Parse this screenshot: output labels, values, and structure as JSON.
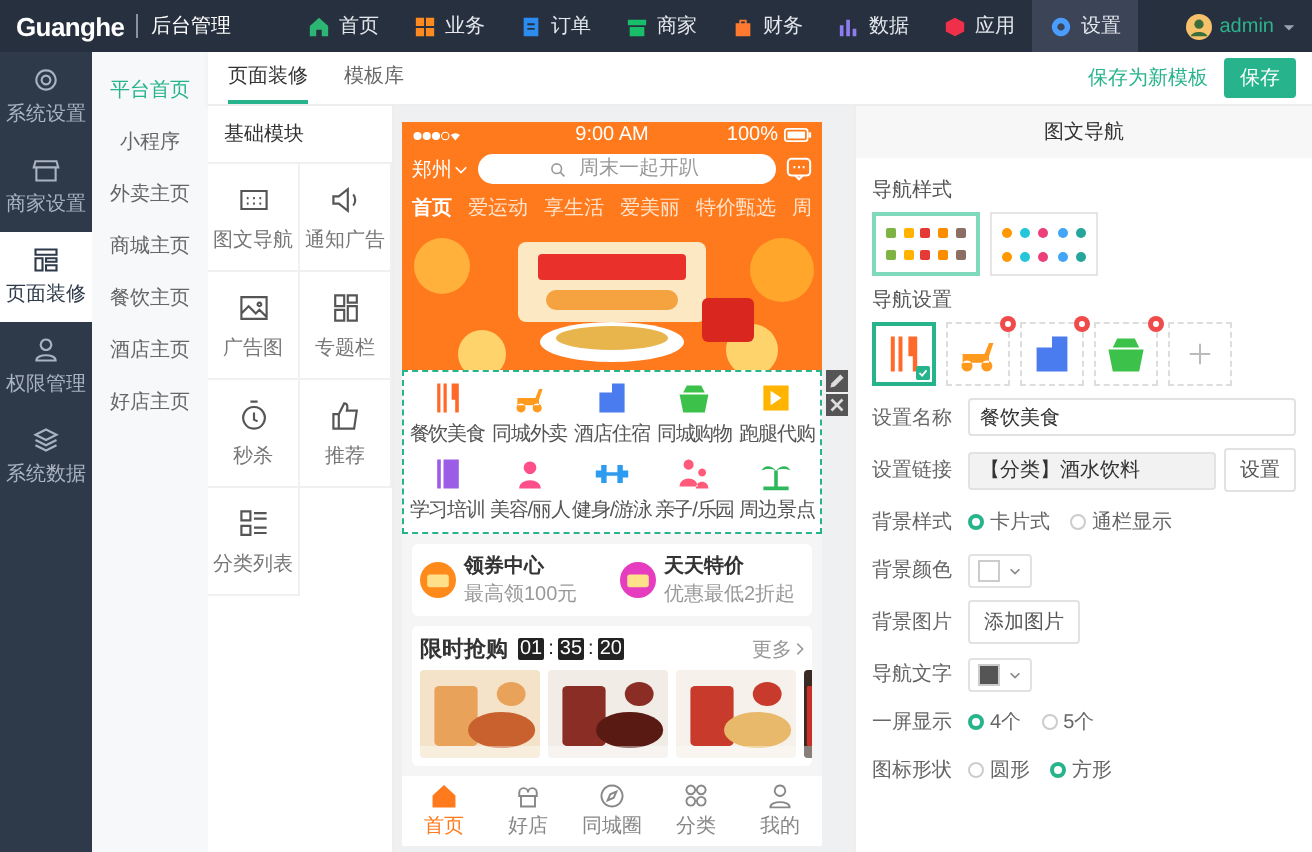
{
  "top_bar": {
    "logo": "Guanghe",
    "title": "后台管理",
    "user": "admin",
    "nav": [
      {
        "label": "首页",
        "color": "#2bb673",
        "selected": false
      },
      {
        "label": "业务",
        "color": "#ff8a1f",
        "selected": false
      },
      {
        "label": "订单",
        "color": "#2d8cf0",
        "selected": false
      },
      {
        "label": "商家",
        "color": "#19be6b",
        "selected": false
      },
      {
        "label": "财务",
        "color": "#ff7a2e",
        "selected": false
      },
      {
        "label": "数据",
        "color": "#8f7cf0",
        "selected": false
      },
      {
        "label": "应用",
        "color": "#f0304a",
        "selected": false
      },
      {
        "label": "设置",
        "color": "#4a9cff",
        "selected": true
      }
    ]
  },
  "rail": [
    {
      "label": "系统设置",
      "selected": false
    },
    {
      "label": "商家设置",
      "selected": false
    },
    {
      "label": "页面装修",
      "selected": true
    },
    {
      "label": "权限管理",
      "selected": false
    },
    {
      "label": "系统数据",
      "selected": false
    }
  ],
  "sub_nav": [
    {
      "label": "平台首页",
      "selected": true
    },
    {
      "label": "小程序",
      "selected": false
    },
    {
      "label": "外卖主页",
      "selected": false
    },
    {
      "label": "商城主页",
      "selected": false
    },
    {
      "label": "餐饮主页",
      "selected": false
    },
    {
      "label": "酒店主页",
      "selected": false
    },
    {
      "label": "好店主页",
      "selected": false
    }
  ],
  "tabs": [
    {
      "label": "页面装修",
      "selected": true
    },
    {
      "label": "模板库",
      "selected": false
    }
  ],
  "actions": {
    "save_template": "保存为新模板",
    "save": "保存"
  },
  "modules": {
    "title": "基础模块",
    "items": [
      "图文导航",
      "通知广告",
      "广告图",
      "专题栏",
      "秒杀",
      "推荐",
      "分类列表"
    ]
  },
  "phone": {
    "status": {
      "time": "9:00 AM",
      "battery": "100%"
    },
    "city": "郑州",
    "search": {
      "placeholder": "周末一起开趴"
    },
    "tabs": [
      {
        "label": "首页",
        "selected": true
      },
      {
        "label": "爱运动",
        "selected": false
      },
      {
        "label": "享生活",
        "selected": false
      },
      {
        "label": "爱美丽",
        "selected": false
      },
      {
        "label": "特价甄选",
        "selected": false
      },
      {
        "label": "周",
        "selected": false
      }
    ],
    "nav_grid": {
      "selected": true,
      "items": [
        {
          "label": "餐饮美食",
          "color": "#ff6a2a"
        },
        {
          "label": "同城外卖",
          "color": "#ff9a1f"
        },
        {
          "label": "酒店住宿",
          "color": "#4a7cf0"
        },
        {
          "label": "同城购物",
          "color": "#3cc24a"
        },
        {
          "label": "跑腿代购",
          "color": "#ffb400"
        },
        {
          "label": "学习培训",
          "color": "#9b5de5"
        },
        {
          "label": "美容/丽人",
          "color": "#ff4f8b"
        },
        {
          "label": "健身/游泳",
          "color": "#2d9cf0"
        },
        {
          "label": "亲子/乐园",
          "color": "#ff5a7a"
        },
        {
          "label": "周边景点",
          "color": "#2eb85c"
        }
      ]
    },
    "promos": [
      {
        "title": "领券中心",
        "subtitle": "最高领100元"
      },
      {
        "title": "天天特价",
        "subtitle": "优惠最低2折起"
      }
    ],
    "flash_sale": {
      "title": "限时抢购",
      "more": "更多",
      "countdown": [
        {
          "kind": "digits",
          "text": "01"
        },
        {
          "kind": "sep",
          "text": ":"
        },
        {
          "kind": "digits",
          "text": "35"
        },
        {
          "kind": "sep",
          "text": ":"
        },
        {
          "kind": "digits",
          "text": "20"
        }
      ]
    },
    "bottom_tabs": [
      {
        "label": "首页",
        "selected": true
      },
      {
        "label": "好店",
        "selected": false
      },
      {
        "label": "同城圈",
        "selected": false
      },
      {
        "label": "分类",
        "selected": false
      },
      {
        "label": "我的",
        "selected": false
      }
    ]
  },
  "panel": {
    "title": "图文导航",
    "style_label": "导航样式",
    "styles": [
      {
        "selected": true
      },
      {
        "selected": false
      }
    ],
    "tiles_label": "导航设置",
    "tiles": [
      {
        "selected": true,
        "removable": false,
        "color": "#ff6a2a"
      },
      {
        "selected": false,
        "removable": true,
        "color": "#ff9a1f"
      },
      {
        "selected": false,
        "removable": true,
        "color": "#4a7cf0"
      },
      {
        "selected": false,
        "removable": true,
        "color": "#3cc24a"
      }
    ],
    "fields": [
      {
        "kind": "text",
        "label": "设置名称",
        "value": "餐饮美食"
      },
      {
        "kind": "link",
        "label": "设置链接",
        "value": "【分类】酒水饮料",
        "button": "设置"
      },
      {
        "kind": "radio",
        "label": "背景样式",
        "options": [
          {
            "label": "卡片式",
            "selected": true
          },
          {
            "label": "通栏显示",
            "selected": false
          }
        ]
      },
      {
        "kind": "color",
        "label": "背景颜色",
        "color": "#ffffff"
      },
      {
        "kind": "button",
        "label": "背景图片",
        "button": "添加图片"
      },
      {
        "kind": "color",
        "label": "导航文字",
        "color": "#555555"
      },
      {
        "kind": "radio",
        "label": "一屏显示",
        "options": [
          {
            "label": "4个",
            "selected": true
          },
          {
            "label": "5个",
            "selected": false
          }
        ]
      },
      {
        "kind": "radio",
        "label": "图标形状",
        "options": [
          {
            "label": "圆形",
            "selected": false
          },
          {
            "label": "方形",
            "selected": true
          }
        ]
      }
    ]
  }
}
